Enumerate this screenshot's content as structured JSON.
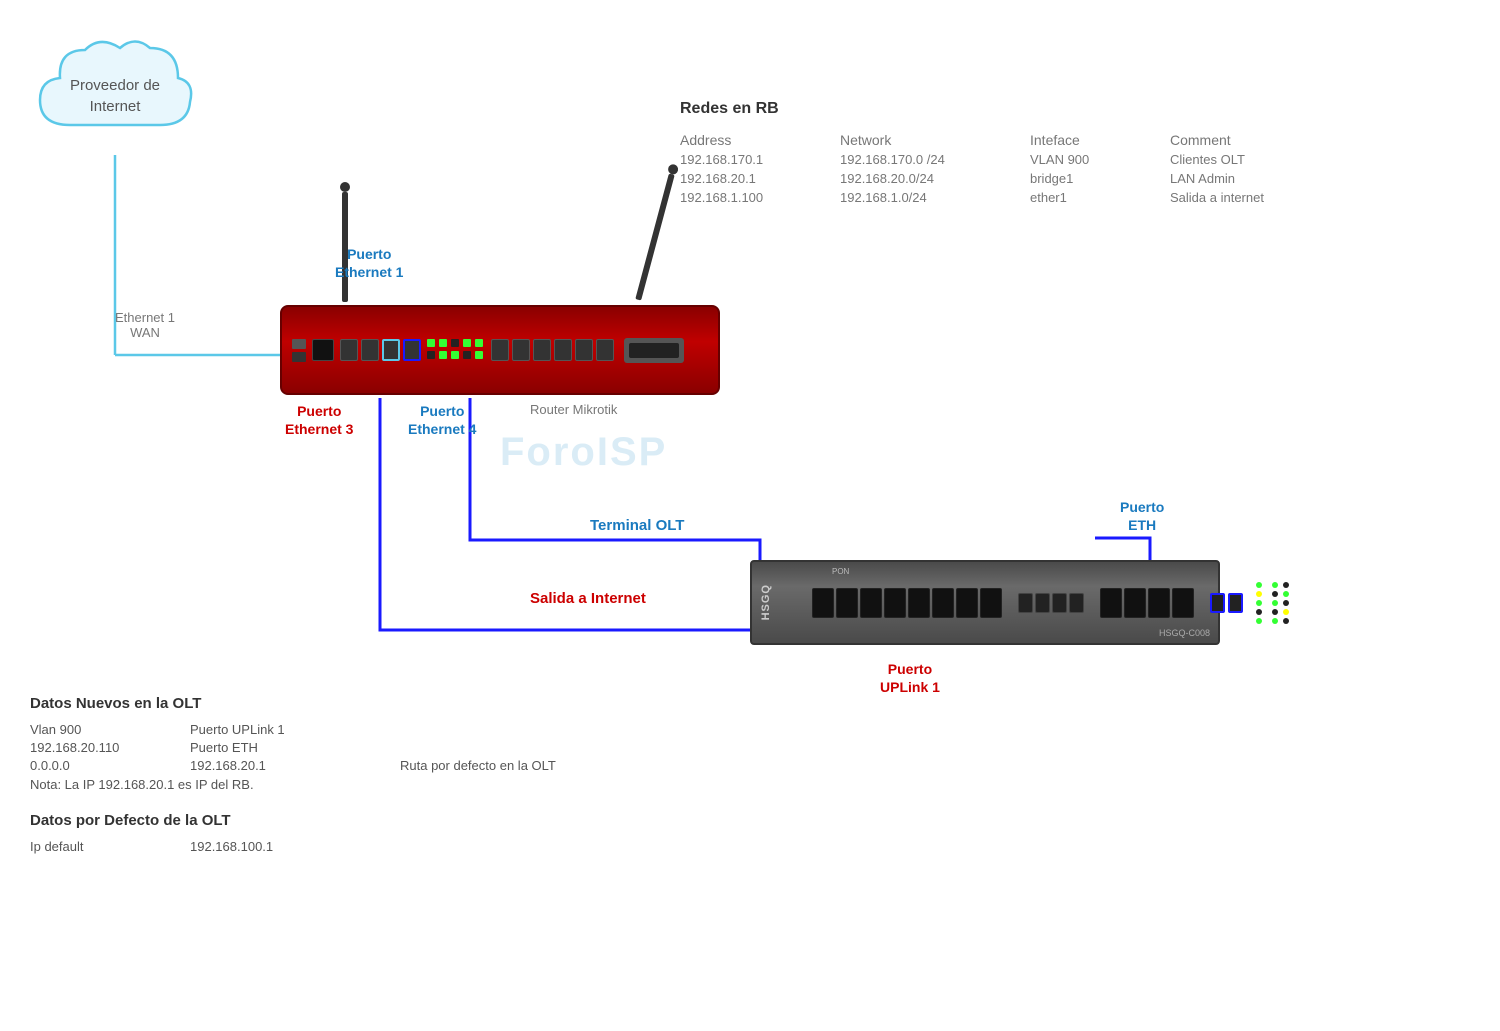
{
  "diagram": {
    "title": "Redes en RB",
    "watermark": "ForoISP",
    "cloud": {
      "label_line1": "Proveedor de",
      "label_line2": "Internet"
    },
    "labels": {
      "eth1_wan": "Ethernet 1\nWAN",
      "router_label": "Router Mikrotik",
      "puerto_eth1": "Puerto\nEthernet 1",
      "puerto_eth3": "Puerto\nEthernet 3",
      "puerto_eth4": "Puerto\nEthernet 4",
      "puerto_eth": "Puerto\nETH",
      "puerto_uplink": "Puerto\nUPLink 1",
      "terminal_olt": "Terminal OLT",
      "salida_internet": "Salida a Internet"
    },
    "table": {
      "headers": [
        "Address",
        "Network",
        "Inteface",
        "Comment"
      ],
      "rows": [
        [
          "192.168.170.1",
          "192.168.170.0 /24",
          "VLAN 900",
          "Clientes OLT"
        ],
        [
          "192.168.20.1",
          "192.168.20.0/24",
          "bridge1",
          "LAN Admin"
        ],
        [
          "192.168.1.100",
          "192.168.1.0/24",
          "ether1",
          "Salida a internet"
        ]
      ]
    },
    "datos_nuevos": {
      "title": "Datos Nuevos en  la OLT",
      "rows": [
        {
          "col1": "Vlan 900",
          "col2": "Puerto UPLink 1",
          "col3": ""
        },
        {
          "col1": "192.168.20.110",
          "col2": "Puerto ETH",
          "col3": ""
        },
        {
          "col1": "0.0.0.0",
          "col2": "192.168.20.1",
          "col3": "Ruta  por defecto en la OLT"
        }
      ],
      "nota": "Nota: La IP 192.168.20.1 es IP del RB."
    },
    "datos_defecto": {
      "title": "Datos por Defecto de la OLT",
      "rows": [
        {
          "label": "Ip default",
          "value": "192.168.100.1"
        }
      ]
    }
  }
}
